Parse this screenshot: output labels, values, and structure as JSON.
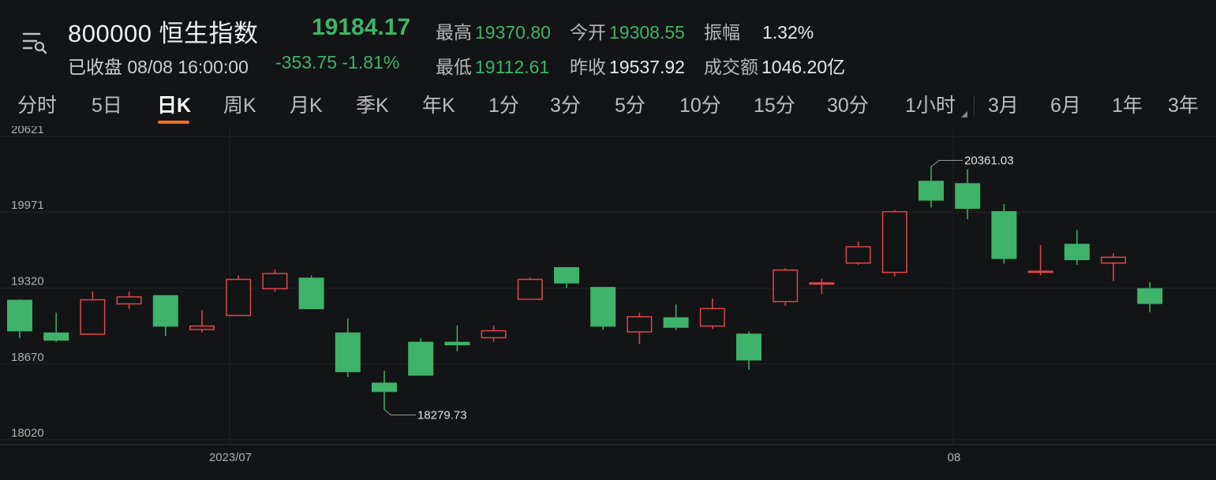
{
  "header": {
    "title": "800000 恒生指数",
    "price": "19184.17",
    "status": "已收盘 08/08 16:00:00",
    "change": "-353.75 -1.81%",
    "stats": [
      {
        "label": "最高",
        "value": "19370.80",
        "color": "green"
      },
      {
        "label": "今开",
        "value": "19308.55",
        "color": "green"
      },
      {
        "label": "振幅",
        "value": "1.32%",
        "color": "white"
      },
      {
        "label": "最低",
        "value": "19112.61",
        "color": "green"
      },
      {
        "label": "昨收",
        "value": "19537.92",
        "color": "white"
      },
      {
        "label": "成交额",
        "value": "1046.20亿",
        "color": "white"
      }
    ]
  },
  "tabs": [
    "分时",
    "5日",
    "日K",
    "周K",
    "月K",
    "季K",
    "年K",
    "1分",
    "3分",
    "5分",
    "10分",
    "15分",
    "30分",
    "1小时",
    "3月",
    "6月",
    "1年",
    "3年"
  ],
  "active_tab": "日K",
  "icons": {
    "menu": "menu-search-icon",
    "period_corner": "dropdown-corner-icon"
  },
  "colors": {
    "up": "#e0464f",
    "down": "#3fb36a",
    "accent": "#f36c21",
    "background": "#131416"
  },
  "chart_data": {
    "type": "candlestick",
    "y_ticks": [
      "20621",
      "19971",
      "19320",
      "18670",
      "18020"
    ],
    "ylim": [
      18020,
      20621
    ],
    "x_ticks": [
      "2023/07",
      "08"
    ],
    "annotations": {
      "high": "20361.03",
      "low": "18279.73"
    },
    "candles": [
      {
        "o": 19220,
        "c": 18950,
        "h": 19225,
        "l": 18890
      },
      {
        "o": 18940,
        "c": 18870,
        "h": 19110,
        "l": 18860
      },
      {
        "o": 18920,
        "c": 19225,
        "h": 19290,
        "l": 18920
      },
      {
        "o": 19180,
        "c": 19250,
        "h": 19290,
        "l": 19140
      },
      {
        "o": 19260,
        "c": 18990,
        "h": 19260,
        "l": 18910
      },
      {
        "o": 18960,
        "c": 19000,
        "h": 19130,
        "l": 18940
      },
      {
        "o": 19080,
        "c": 19400,
        "h": 19430,
        "l": 19080
      },
      {
        "o": 19310,
        "c": 19450,
        "h": 19480,
        "l": 19290
      },
      {
        "o": 19410,
        "c": 19140,
        "h": 19430,
        "l": 19140
      },
      {
        "o": 18940,
        "c": 18600,
        "h": 19060,
        "l": 18560
      },
      {
        "o": 18510,
        "c": 18430,
        "h": 18610,
        "l": 18279.73
      },
      {
        "o": 18860,
        "c": 18570,
        "h": 18890,
        "l": 18570
      },
      {
        "o": 18860,
        "c": 18830,
        "h": 19000,
        "l": 18780
      },
      {
        "o": 18890,
        "c": 18960,
        "h": 19000,
        "l": 18860
      },
      {
        "o": 19220,
        "c": 19400,
        "h": 19410,
        "l": 19220
      },
      {
        "o": 19500,
        "c": 19360,
        "h": 19500,
        "l": 19320
      },
      {
        "o": 19330,
        "c": 18990,
        "h": 19330,
        "l": 18960
      },
      {
        "o": 18940,
        "c": 19080,
        "h": 19110,
        "l": 18840
      },
      {
        "o": 19070,
        "c": 18980,
        "h": 19180,
        "l": 18960
      },
      {
        "o": 18990,
        "c": 19150,
        "h": 19230,
        "l": 18970
      },
      {
        "o": 18930,
        "c": 18700,
        "h": 18950,
        "l": 18620
      },
      {
        "o": 19200,
        "c": 19480,
        "h": 19490,
        "l": 19170
      },
      {
        "o": 19350,
        "c": 19370,
        "h": 19400,
        "l": 19270
      },
      {
        "o": 19530,
        "c": 19680,
        "h": 19720,
        "l": 19520
      },
      {
        "o": 19450,
        "c": 19980,
        "h": 19990,
        "l": 19420
      },
      {
        "o": 20240,
        "c": 20070,
        "h": 20361.03,
        "l": 20010
      },
      {
        "o": 20220,
        "c": 20000,
        "h": 20340,
        "l": 19910
      },
      {
        "o": 19980,
        "c": 19570,
        "h": 20040,
        "l": 19530
      },
      {
        "o": 19450,
        "c": 19470,
        "h": 19690,
        "l": 19430
      },
      {
        "o": 19700,
        "c": 19560,
        "h": 19820,
        "l": 19520
      },
      {
        "o": 19530,
        "c": 19590,
        "h": 19620,
        "l": 19380
      },
      {
        "o": 19320,
        "c": 19184.17,
        "h": 19370.8,
        "l": 19112.61
      }
    ]
  }
}
